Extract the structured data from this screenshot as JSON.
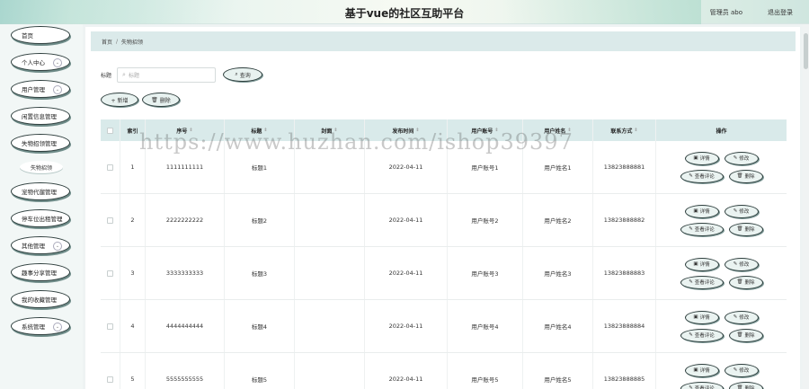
{
  "header": {
    "title": "基于vue的社区互助平台",
    "user": "管理员 abo",
    "logout": "退出登录"
  },
  "sidebar": {
    "items": [
      {
        "label": "首页",
        "chevron": false
      },
      {
        "label": "个人中心",
        "chevron": true
      },
      {
        "label": "用户管理",
        "chevron": true
      },
      {
        "label": "闲置信息管理",
        "chevron": true
      },
      {
        "label": "失物招领管理",
        "chevron": true
      },
      {
        "label": "宠物代遛管理",
        "chevron": true
      },
      {
        "label": "停车位出租管理",
        "chevron": true
      },
      {
        "label": "其他管理",
        "chevron": true
      },
      {
        "label": "趣事分享管理",
        "chevron": true
      },
      {
        "label": "我的收藏管理",
        "chevron": true
      },
      {
        "label": "系统管理",
        "chevron": true
      }
    ],
    "sub_item": "失物招领",
    "chevron_glyph": "⌄"
  },
  "breadcrumb": {
    "home": "首页",
    "sep": "/",
    "current": "失物招领"
  },
  "search": {
    "label": "标题",
    "placeholder": "标题",
    "button": "查询"
  },
  "actions": {
    "add": "+ 新增",
    "delete": "删除"
  },
  "table": {
    "headers": {
      "index": "索引",
      "no": "序号",
      "title": "标题",
      "cover": "封面",
      "time": "发布时间",
      "account": "用户账号",
      "name": "用户姓名",
      "phone": "联系方式",
      "op": "操作"
    },
    "sort_glyph": "⇕",
    "rows": [
      {
        "index": "1",
        "no": "1111111111",
        "title": "标题1",
        "time": "2022-04-11",
        "account": "用户账号1",
        "name": "用户姓名1",
        "phone": "13823888881"
      },
      {
        "index": "2",
        "no": "2222222222",
        "title": "标题2",
        "time": "2022-04-11",
        "account": "用户账号2",
        "name": "用户姓名2",
        "phone": "13823888882"
      },
      {
        "index": "3",
        "no": "3333333333",
        "title": "标题3",
        "time": "2022-04-11",
        "account": "用户账号3",
        "name": "用户姓名3",
        "phone": "13823888883"
      },
      {
        "index": "4",
        "no": "4444444444",
        "title": "标题4",
        "time": "2022-04-11",
        "account": "用户账号4",
        "name": "用户姓名4",
        "phone": "13823888884"
      },
      {
        "index": "5",
        "no": "5555555555",
        "title": "标题5",
        "time": "2022-04-11",
        "account": "用户账号5",
        "name": "用户姓名5",
        "phone": "13823888885"
      }
    ],
    "op_buttons": {
      "detail": "详情",
      "edit": "修改",
      "comment": "查看评论",
      "delete": "删除"
    }
  },
  "watermark": "https://www.huzhan.com/ishop39397",
  "colors": {
    "accent": "#d9eaea",
    "border": "#2e3e3d"
  }
}
